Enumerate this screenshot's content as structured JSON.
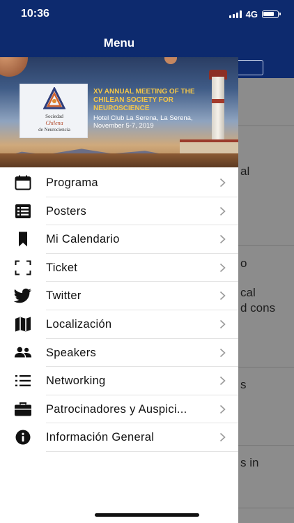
{
  "status_bar": {
    "time": "10:36",
    "network": "4G"
  },
  "drawer": {
    "title": "Menu",
    "header_color": "#0d2a6e"
  },
  "banner": {
    "logo_text_top": "Sociedad",
    "logo_text_middle": "Chilena",
    "logo_text_bottom": "de Neurociencia",
    "heading": "XV ANNUAL MEETING OF THE CHILEAN SOCIETY FOR NEUROSCIENCE",
    "venue": "Hotel Club La Serena, La Serena,",
    "dates": "November 5-7, 2019"
  },
  "menu_items": [
    {
      "label": "Programa",
      "icon": "calendar-icon"
    },
    {
      "label": "Posters",
      "icon": "list-box-icon"
    },
    {
      "label": "Mi Calendario",
      "icon": "bookmark-icon"
    },
    {
      "label": "Ticket",
      "icon": "scan-frame-icon"
    },
    {
      "label": "Twitter",
      "icon": "twitter-bird-icon"
    },
    {
      "label": "Localización",
      "icon": "map-icon"
    },
    {
      "label": "Speakers",
      "icon": "people-icon"
    },
    {
      "label": "Networking",
      "icon": "bullet-list-icon"
    },
    {
      "label": "Patrocinadores y Auspici...",
      "icon": "briefcase-icon"
    },
    {
      "label": "Información General",
      "icon": "info-circle-icon"
    }
  ],
  "background_content": {
    "fragments": [
      "al",
      "o",
      "cal",
      "d cons",
      "s",
      "s in"
    ]
  }
}
